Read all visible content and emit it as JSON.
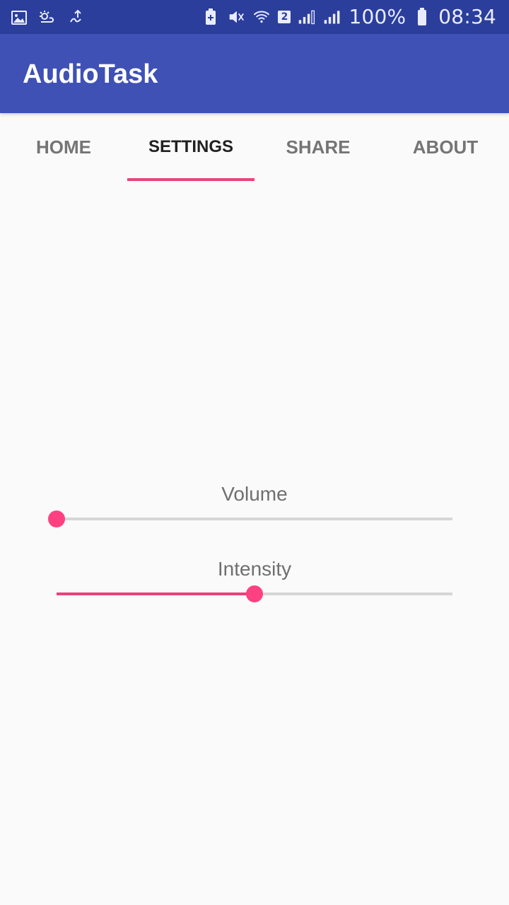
{
  "status_bar": {
    "left_icons": [
      "image-icon",
      "weather-icon",
      "gesture-icon"
    ],
    "right_icons": [
      "battery-saver-icon",
      "mute-icon",
      "wifi-icon",
      "signal-icon",
      "signal-icon",
      "battery-icon"
    ],
    "sim_badge": "2",
    "battery": "100%",
    "time": "08:34"
  },
  "app_bar": {
    "title": "AudioTask"
  },
  "tabs": [
    {
      "label": "HOME",
      "active": false
    },
    {
      "label": "SETTINGS",
      "active": true
    },
    {
      "label": "SHARE",
      "active": false
    },
    {
      "label": "ABOUT",
      "active": false
    }
  ],
  "settings": {
    "volume": {
      "label": "Volume",
      "value": 0
    },
    "intensity": {
      "label": "Intensity",
      "value": 0.5
    }
  },
  "colors": {
    "status_bar": "#2b3e9c",
    "app_bar": "#3f51b5",
    "accent": "#ff4081",
    "background": "#fafafa"
  }
}
